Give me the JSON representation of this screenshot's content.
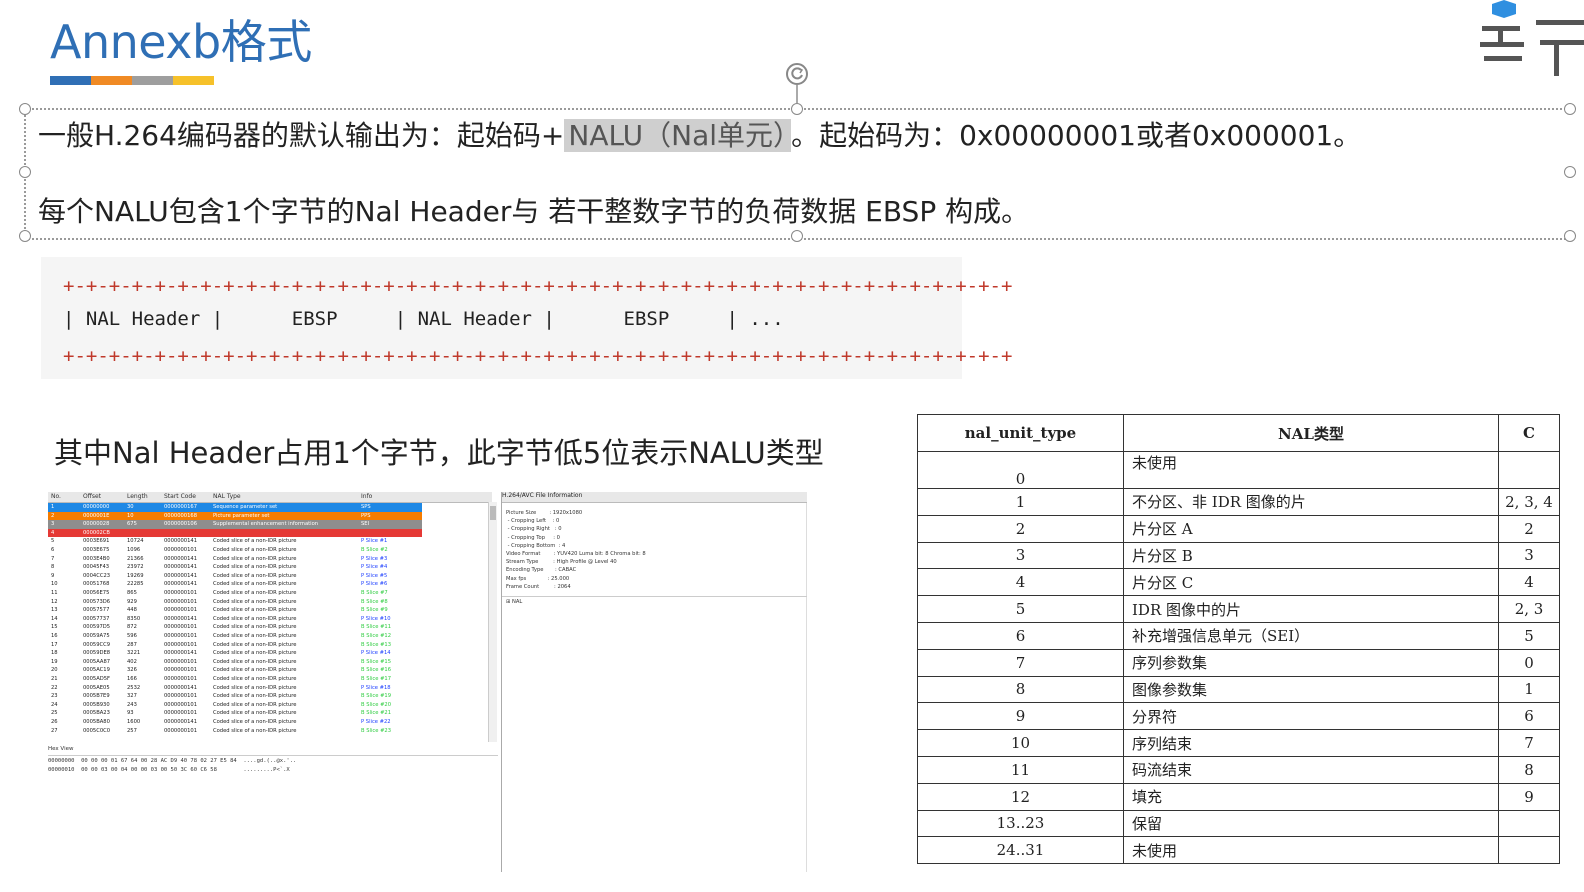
{
  "slide": {
    "title": "Annexb格式",
    "title_bar_colors": [
      "#2f6fb5",
      "#f08a24",
      "#9e9e9e",
      "#f6c12a"
    ],
    "line1_pre": "一般H.264编码器的默认输出为：起始码+",
    "line1_highlight": "NALU（Nal单元）",
    "line1_post": "。起始码为：0x00000001或者0x000001。",
    "line2": "每个NALU包含1个字节的Nal Header与 若干整数字节的负荷数据 EBSP 构成。",
    "code_border": "+-+-+-+-+-+-+-+-+-+-+-+-+-+-+-+-+-+-+-+-+-+-+-+-+-+-+-+-+-+-+-+-+-+-+-+-+-+-+-+-+-+",
    "code_middle": "| NAL Header |      EBSP     | NAL Header |      EBSP     | ...",
    "subhead": "其中Nal Header占用1个字节，此字节低5位表示NALU类型"
  },
  "analyzer": {
    "columns": [
      "No.",
      "Offset",
      "Length",
      "Start Code",
      "NAL Type",
      "Info"
    ],
    "rows": [
      {
        "no": "1",
        "offset": "00000000",
        "length": "30",
        "start": "0000000167",
        "type": "Sequence parameter set",
        "info": "SPS",
        "bg": "#1e88e5",
        "fg": "#ffffff"
      },
      {
        "no": "2",
        "offset": "0000001E",
        "length": "10",
        "start": "0000000168",
        "type": "Picture parameter set",
        "info": "PPS",
        "bg": "#f57c00",
        "fg": "#ffffff"
      },
      {
        "no": "3",
        "offset": "00000028",
        "length": "675",
        "start": "0000000106",
        "type": "Supplemental enhancement information",
        "info": "SEI",
        "bg": "#8e8e8e",
        "fg": "#ffffff"
      },
      {
        "no": "4",
        "offset": "000002CB",
        "length": "",
        "start": "",
        "type": "",
        "info": "",
        "bg": "#e53935",
        "fg": "#ffffff"
      },
      {
        "no": "5",
        "offset": "0003E691",
        "length": "10724",
        "start": "0000000141",
        "type": "Coded slice of a non-IDR picture",
        "info": "P Slice #1",
        "bg": "#ffffff",
        "fg": "#222",
        "infofg": "#1e40ff"
      },
      {
        "no": "6",
        "offset": "0003E675",
        "length": "1096",
        "start": "0000000101",
        "type": "Coded slice of a non-IDR picture",
        "info": "B Slice #2",
        "bg": "#ffffff",
        "fg": "#222",
        "infofg": "#2ecc40"
      },
      {
        "no": "7",
        "offset": "0003E4B0",
        "length": "21366",
        "start": "0000000141",
        "type": "Coded slice of a non-IDR picture",
        "info": "P Slice #3",
        "bg": "#ffffff",
        "fg": "#222",
        "infofg": "#1e40ff"
      },
      {
        "no": "8",
        "offset": "00045F43",
        "length": "23972",
        "start": "0000000141",
        "type": "Coded slice of a non-IDR picture",
        "info": "P Slice #4",
        "bg": "#ffffff",
        "fg": "#222",
        "infofg": "#1e40ff"
      },
      {
        "no": "9",
        "offset": "0004CC23",
        "length": "19269",
        "start": "0000000141",
        "type": "Coded slice of a non-IDR picture",
        "info": "P Slice #5",
        "bg": "#ffffff",
        "fg": "#222",
        "infofg": "#1e40ff"
      },
      {
        "no": "10",
        "offset": "00051768",
        "length": "22285",
        "start": "0000000141",
        "type": "Coded slice of a non-IDR picture",
        "info": "P Slice #6",
        "bg": "#ffffff",
        "fg": "#222",
        "infofg": "#1e40ff"
      },
      {
        "no": "11",
        "offset": "00056E75",
        "length": "865",
        "start": "0000000101",
        "type": "Coded slice of a non-IDR picture",
        "info": "B Slice #7",
        "bg": "#ffffff",
        "fg": "#222",
        "infofg": "#2ecc40"
      },
      {
        "no": "12",
        "offset": "000573D6",
        "length": "929",
        "start": "0000000101",
        "type": "Coded slice of a non-IDR picture",
        "info": "B Slice #8",
        "bg": "#ffffff",
        "fg": "#222",
        "infofg": "#2ecc40"
      },
      {
        "no": "13",
        "offset": "00057577",
        "length": "448",
        "start": "0000000101",
        "type": "Coded slice of a non-IDR picture",
        "info": "B Slice #9",
        "bg": "#ffffff",
        "fg": "#222",
        "infofg": "#2ecc40"
      },
      {
        "no": "14",
        "offset": "00057737",
        "length": "8350",
        "start": "0000000141",
        "type": "Coded slice of a non-IDR picture",
        "info": "P Slice #10",
        "bg": "#ffffff",
        "fg": "#222",
        "infofg": "#1e40ff"
      },
      {
        "no": "15",
        "offset": "000597D5",
        "length": "872",
        "start": "0000000101",
        "type": "Coded slice of a non-IDR picture",
        "info": "B Slice #11",
        "bg": "#ffffff",
        "fg": "#222",
        "infofg": "#2ecc40"
      },
      {
        "no": "16",
        "offset": "00059A75",
        "length": "596",
        "start": "0000000101",
        "type": "Coded slice of a non-IDR picture",
        "info": "B Slice #12",
        "bg": "#ffffff",
        "fg": "#222",
        "infofg": "#2ecc40"
      },
      {
        "no": "17",
        "offset": "00059CC9",
        "length": "287",
        "start": "0000000101",
        "type": "Coded slice of a non-IDR picture",
        "info": "B Slice #13",
        "bg": "#ffffff",
        "fg": "#222",
        "infofg": "#2ecc40"
      },
      {
        "no": "18",
        "offset": "00059DE8",
        "length": "3221",
        "start": "0000000141",
        "type": "Coded slice of a non-IDR picture",
        "info": "P Slice #14",
        "bg": "#ffffff",
        "fg": "#222",
        "infofg": "#1e40ff"
      },
      {
        "no": "19",
        "offset": "0005AA87",
        "length": "402",
        "start": "0000000101",
        "type": "Coded slice of a non-IDR picture",
        "info": "B Slice #15",
        "bg": "#ffffff",
        "fg": "#222",
        "infofg": "#2ecc40"
      },
      {
        "no": "20",
        "offset": "0005AC19",
        "length": "326",
        "start": "0000000101",
        "type": "Coded slice of a non-IDR picture",
        "info": "B Slice #16",
        "bg": "#ffffff",
        "fg": "#222",
        "infofg": "#2ecc40"
      },
      {
        "no": "21",
        "offset": "0005AD5F",
        "length": "166",
        "start": "0000000101",
        "type": "Coded slice of a non-IDR picture",
        "info": "B Slice #17",
        "bg": "#ffffff",
        "fg": "#222",
        "infofg": "#2ecc40"
      },
      {
        "no": "22",
        "offset": "0005AE05",
        "length": "2532",
        "start": "0000000141",
        "type": "Coded slice of a non-IDR picture",
        "info": "P Slice #18",
        "bg": "#ffffff",
        "fg": "#222",
        "infofg": "#1e40ff"
      },
      {
        "no": "23",
        "offset": "0005B7E9",
        "length": "327",
        "start": "0000000101",
        "type": "Coded slice of a non-IDR picture",
        "info": "B Slice #19",
        "bg": "#ffffff",
        "fg": "#222",
        "infofg": "#2ecc40"
      },
      {
        "no": "24",
        "offset": "0005B930",
        "length": "243",
        "start": "0000000101",
        "type": "Coded slice of a non-IDR picture",
        "info": "B Slice #20",
        "bg": "#ffffff",
        "fg": "#222",
        "infofg": "#2ecc40"
      },
      {
        "no": "25",
        "offset": "0005BA23",
        "length": "93",
        "start": "0000000101",
        "type": "Coded slice of a non-IDR picture",
        "info": "B Slice #21",
        "bg": "#ffffff",
        "fg": "#222",
        "infofg": "#2ecc40"
      },
      {
        "no": "26",
        "offset": "0005BA80",
        "length": "1600",
        "start": "0000000141",
        "type": "Coded slice of a non-IDR picture",
        "info": "P Slice #22",
        "bg": "#ffffff",
        "fg": "#222",
        "infofg": "#1e40ff"
      },
      {
        "no": "27",
        "offset": "0005C0C0",
        "length": "257",
        "start": "0000000101",
        "type": "Coded slice of a non-IDR picture",
        "info": "B Slice #23",
        "bg": "#ffffff",
        "fg": "#222",
        "infofg": "#2ecc40"
      }
    ],
    "hex_label": "Hex View",
    "hex_lines": [
      "00000000  00 00 00 01 67 64 00 28 AC D9 40 78 02 27 E5 84  ....gd.(..@x.'..",
      "00000010  00 00 03 00 04 00 00 03 00 50 3C 60 C6 58        .........P<`.X"
    ],
    "info_header": "H.264/AVC File Information",
    "info_lines": [
      "Picture Size        : 1920x1080",
      " - Cropping Left    : 0",
      " - Cropping Right   : 0",
      " - Cropping Top     : 0",
      " - Cropping Bottom  : 4",
      "Video Format        : YUV420 Luma bit: 8 Chroma bit: 8",
      "Stream Type         : High Profile @ Level 40",
      "Encoding Type       : CABAC",
      "Max fps             : 25.000",
      "Frame Count         : 2064"
    ],
    "tree_label": "NAL"
  },
  "nal_table": {
    "headers": [
      "nal_unit_type",
      "NAL类型",
      "C"
    ],
    "rows": [
      [
        "0",
        "未使用",
        ""
      ],
      [
        "1",
        "不分区、非 IDR 图像的片",
        "2, 3, 4"
      ],
      [
        "2",
        "片分区 A",
        "2"
      ],
      [
        "3",
        "片分区 B",
        "3"
      ],
      [
        "4",
        "片分区 C",
        "4"
      ],
      [
        "5",
        "IDR 图像中的片",
        "2, 3"
      ],
      [
        "6",
        "补充增强信息单元（SEI）",
        "5"
      ],
      [
        "7",
        "序列参数集",
        "0"
      ],
      [
        "8",
        "图像参数集",
        "1"
      ],
      [
        "9",
        "分界符",
        "6"
      ],
      [
        "10",
        "序列结束",
        "7"
      ],
      [
        "11",
        "码流结束",
        "8"
      ],
      [
        "12",
        "填充",
        "9"
      ],
      [
        "13..23",
        "保留",
        ""
      ],
      [
        "24..31",
        "未使用",
        ""
      ]
    ]
  }
}
